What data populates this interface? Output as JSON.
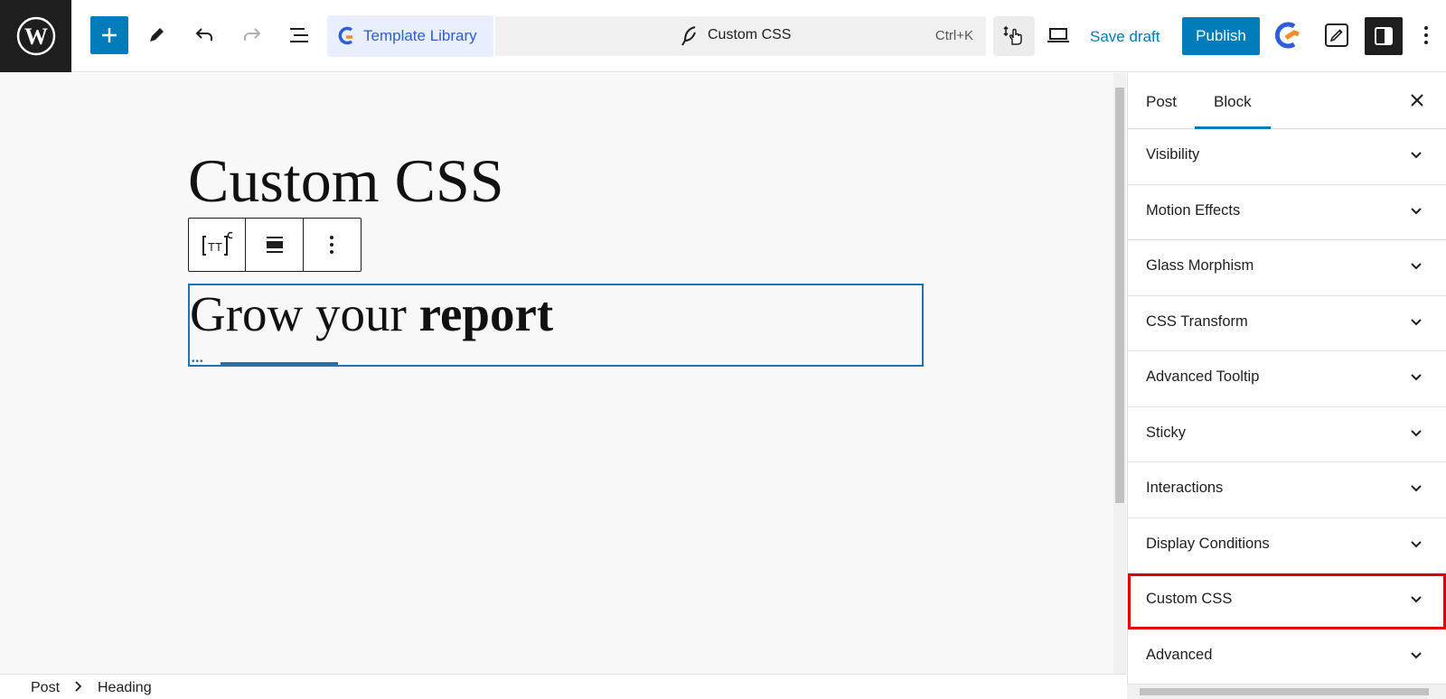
{
  "topbar": {
    "template_library_label": "Template Library",
    "document_title": "Custom CSS",
    "shortcut": "Ctrl+K",
    "save_draft_label": "Save draft",
    "publish_label": "Publish"
  },
  "canvas": {
    "post_title": "Custom CSS",
    "heading_regular": "Grow your ",
    "heading_bold": "report"
  },
  "footer": {
    "breadcrumb": [
      "Post",
      "Heading"
    ]
  },
  "sidebar": {
    "tabs": [
      "Post",
      "Block"
    ],
    "active_tab": "Block",
    "panels": [
      {
        "label": "Visibility"
      },
      {
        "label": "Motion Effects"
      },
      {
        "label": "Glass Morphism"
      },
      {
        "label": "CSS Transform"
      },
      {
        "label": "Advanced Tooltip"
      },
      {
        "label": "Sticky"
      },
      {
        "label": "Interactions"
      },
      {
        "label": "Display Conditions"
      },
      {
        "label": "Custom CSS"
      },
      {
        "label": "Advanced"
      }
    ],
    "highlighted_panel": "Custom CSS"
  },
  "colors": {
    "accent": "#007cba",
    "highlight": "#e00000",
    "brand_orange": "#f28c28",
    "brand_blue": "#2c5ed8"
  }
}
